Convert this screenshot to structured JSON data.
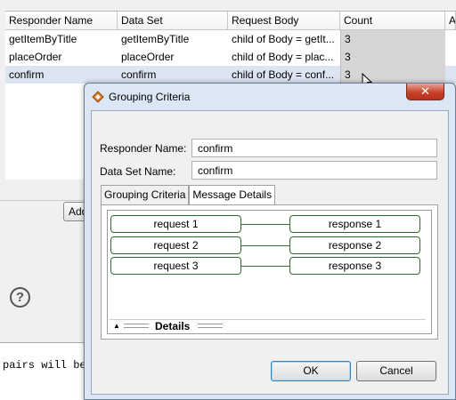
{
  "table": {
    "headers": [
      "Responder Name",
      "Data Set",
      "Request Body",
      "Count",
      "A"
    ],
    "rows": [
      [
        "getItemByTitle",
        "getItemByTitle",
        "child of Body = getIt...",
        "3"
      ],
      [
        "placeOrder",
        "placeOrder",
        "child of Body = plac...",
        "3"
      ],
      [
        "confirm",
        "confirm",
        "child of Body = conf...",
        "3"
      ]
    ]
  },
  "background": {
    "add_label": "Add",
    "help_symbol": "?",
    "console_text": "pairs will be"
  },
  "dialog": {
    "title": "Grouping Criteria",
    "close_symbol": "✕",
    "responder_label": "Responder Name:",
    "responder_value": "confirm",
    "dataset_label": "Data Set Name:",
    "dataset_value": "confirm",
    "tabs": [
      "Grouping Criteria",
      "Message Details"
    ],
    "requests": [
      "request 1",
      "request 2",
      "request 3"
    ],
    "responses": [
      "response 1",
      "response 2",
      "response 3"
    ],
    "details_label": "Details",
    "ok_label": "OK",
    "cancel_label": "Cancel"
  },
  "colors": {
    "pill_border": "#2e6b2e",
    "selected_row": "#dde4f3",
    "close_red": "#c7432c"
  }
}
